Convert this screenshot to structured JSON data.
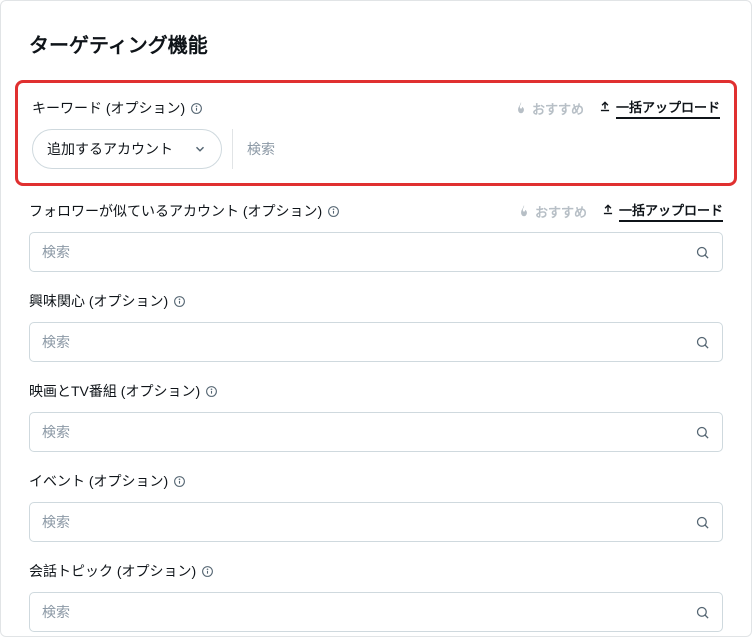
{
  "title": "ターゲティング機能",
  "recommend_label": "おすすめ",
  "bulk_upload_label": "一括アップロード",
  "sections": {
    "keywords": {
      "label": "キーワード (オプション)",
      "account_select": "追加するアカウント",
      "search_placeholder": "検索"
    },
    "followers": {
      "label": "フォロワーが似ているアカウント (オプション)",
      "search_placeholder": "検索"
    },
    "interests": {
      "label": "興味関心 (オプション)",
      "search_placeholder": "検索"
    },
    "movies_tv": {
      "label": "映画とTV番組 (オプション)",
      "search_placeholder": "検索"
    },
    "events": {
      "label": "イベント (オプション)",
      "search_placeholder": "検索"
    },
    "conversation": {
      "label": "会話トピック (オプション)",
      "search_placeholder": "検索"
    }
  }
}
